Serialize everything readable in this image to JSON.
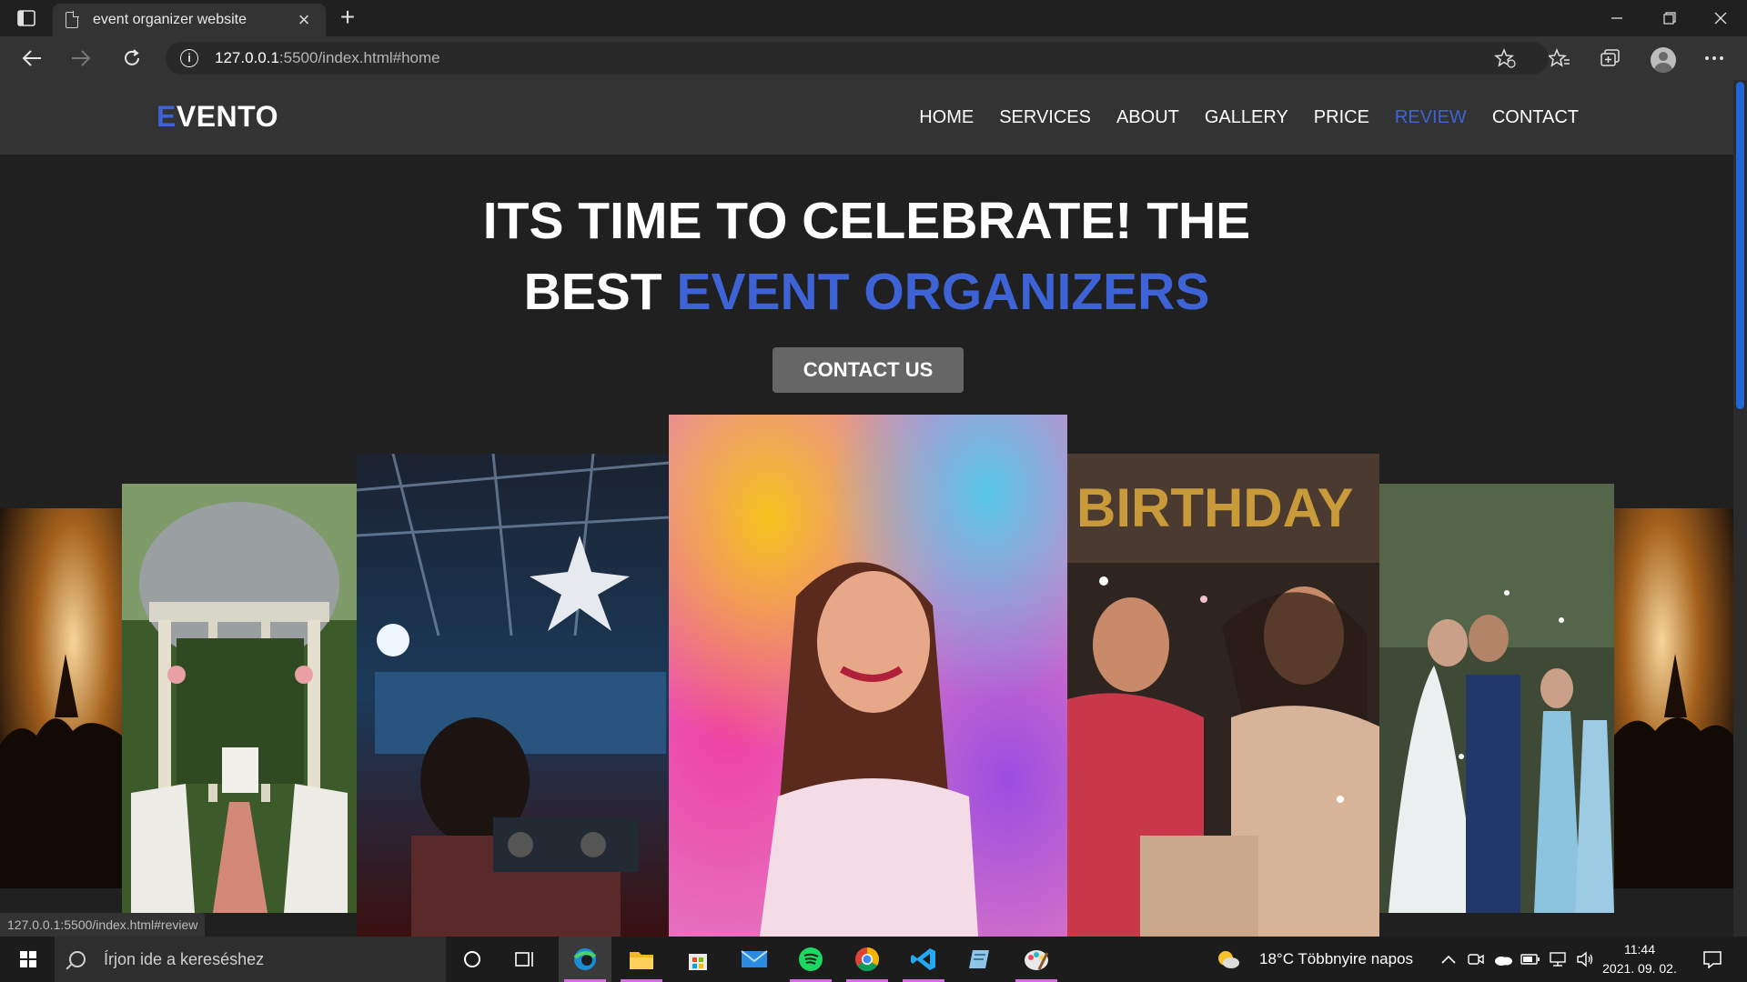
{
  "browser": {
    "tab_title": "event organizer website",
    "tab_close": "×",
    "new_tab": "+",
    "url_host": "127.0.0.1",
    "url_path": ":5500/index.html#home",
    "status_url": "127.0.0.1:5500/index.html#review"
  },
  "site": {
    "logo_first": "E",
    "logo_rest": "VENTO",
    "nav": [
      "HOME",
      "SERVICES",
      "ABOUT",
      "GALLERY",
      "PRICE",
      "REVIEW",
      "CONTACT"
    ],
    "active_nav": "REVIEW",
    "hero_line1": "ITS TIME TO CELEBRATE! THE",
    "hero_line2_plain": "BEST ",
    "hero_line2_accent": "EVENT ORGANIZERS",
    "cta_label": "CONTACT US"
  },
  "gallery": {
    "photos": [
      "concert-photo",
      "gazebo-photo",
      "dj-party-photo",
      "holi-colors-photo",
      "birthday-photo",
      "wedding-photo",
      "concert-photo-right"
    ]
  },
  "taskbar": {
    "search_placeholder": "Írjon ide a kereséshez",
    "weather": "18°C  Többnyire napos",
    "time": "11:44",
    "date": "2021. 09. 02."
  },
  "colors": {
    "accent": "#3d63d6",
    "header_bg": "#333333",
    "page_bg": "#202020",
    "button_bg": "#666666"
  }
}
